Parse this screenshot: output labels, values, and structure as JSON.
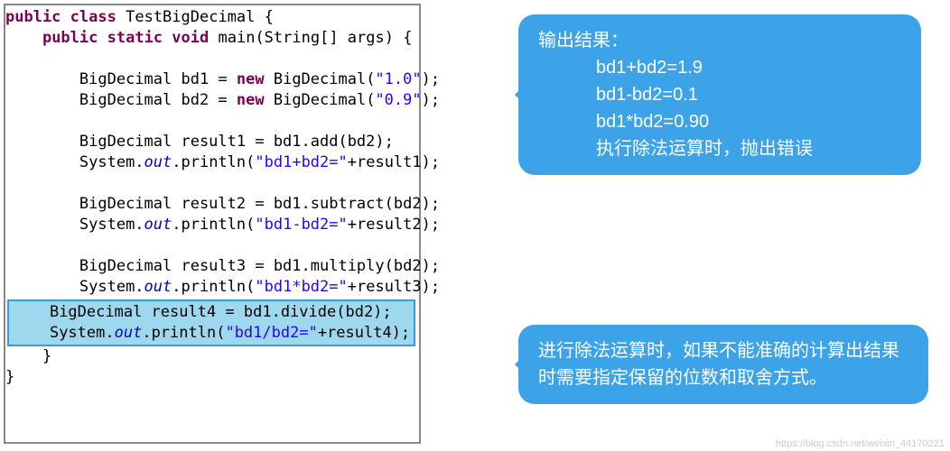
{
  "code": {
    "l1_kw1": "public",
    "l1_kw2": "class",
    "l1_name": "TestBigDecimal {",
    "l2_kw1": "public",
    "l2_kw2": "static",
    "l2_kw3": "void",
    "l2_rest": "main(String[] args) {",
    "l3a": "BigDecimal bd1 = ",
    "l3_kw": "new",
    "l3b": " BigDecimal(",
    "l3_str": "\"1.0\"",
    "l3c": ");",
    "l4a": "BigDecimal bd2 = ",
    "l4_kw": "new",
    "l4b": " BigDecimal(",
    "l4_str": "\"0.9\"",
    "l4c": ");",
    "l5": "BigDecimal result1 = bd1.add(bd2);",
    "l6a": "System.",
    "l6_fld": "out",
    "l6b": ".println(",
    "l6_str": "\"bd1+bd2=\"",
    "l6c": "+result1);",
    "l7": "BigDecimal result2 = bd1.subtract(bd2);",
    "l8a": "System.",
    "l8_fld": "out",
    "l8b": ".println(",
    "l8_str": "\"bd1-bd2=\"",
    "l8c": "+result2);",
    "l9": "BigDecimal result3 = bd1.multiply(bd2);",
    "l10a": "System.",
    "l10_fld": "out",
    "l10b": ".println(",
    "l10_str": "\"bd1*bd2=\"",
    "l10c": "+result3);",
    "hl1": "BigDecimal result4 = bd1.divide(bd2);",
    "hl2a": "System.",
    "hl2_fld": "out",
    "hl2b": ".println(",
    "hl2_str": "\"bd1/bd2=\"",
    "hl2c": "+result4);",
    "close1": "}",
    "close2": "}"
  },
  "bubble1": {
    "title": "输出结果：",
    "r1": "bd1+bd2=1.9",
    "r2": "bd1-bd2=0.1",
    "r3": "bd1*bd2=0.90",
    "r4": "执行除法运算时，抛出错误"
  },
  "bubble2": {
    "text": "进行除法运算时，如果不能准确的计算出结果时需要指定保留的位数和取舍方式。"
  },
  "watermark": "https://blog.csdn.net/weixin_44170221"
}
